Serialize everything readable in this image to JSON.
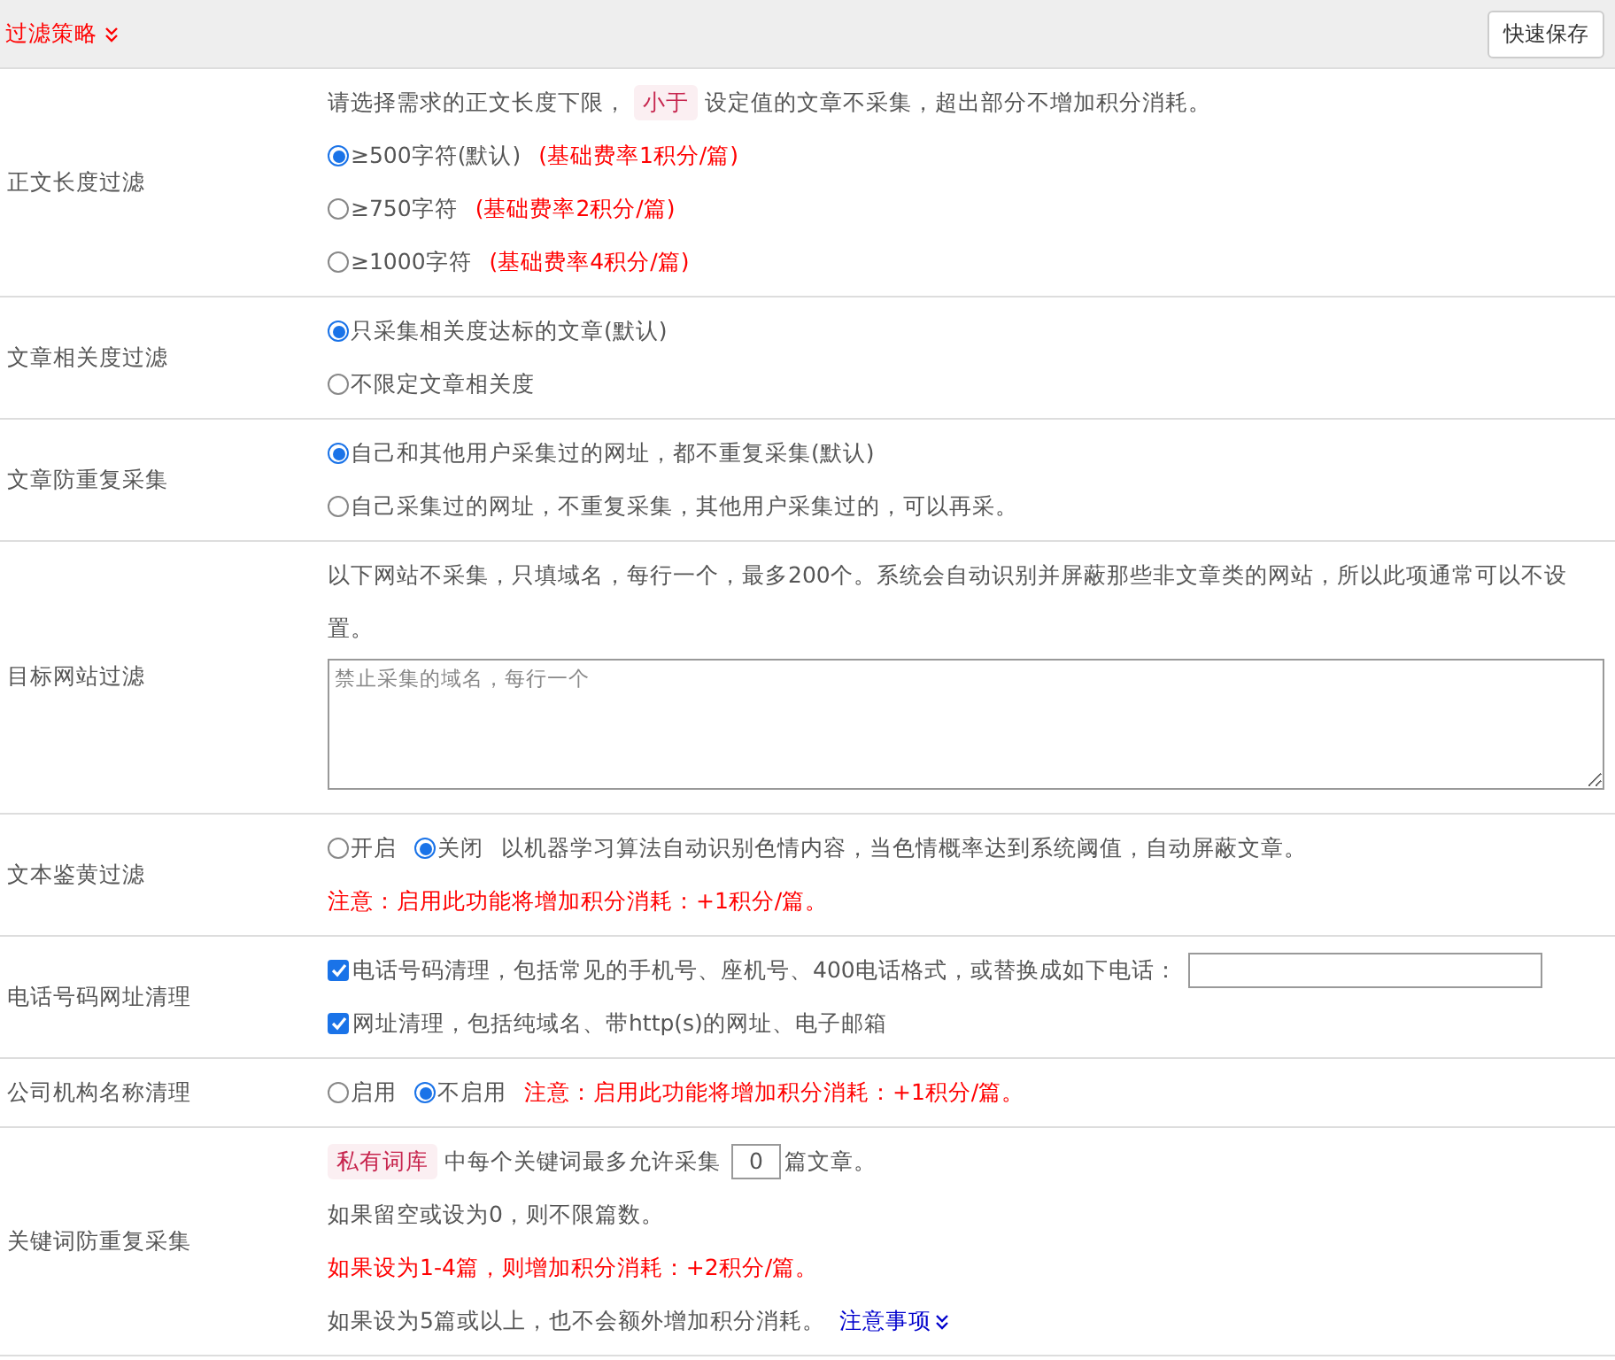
{
  "header": {
    "title": "过滤策略",
    "save_button": "快速保存"
  },
  "rows": [
    {
      "label": "正文长度过滤",
      "lines": [
        {
          "kind": "text",
          "parts": [
            {
              "kind": "plain",
              "text": "请选择需求的正文长度下限，"
            },
            {
              "kind": "tag",
              "text": "小于"
            },
            {
              "kind": "plain",
              "text": "设定值的文章不采集，超出部分不增加积分消耗。"
            }
          ]
        },
        {
          "kind": "options",
          "options": [
            {
              "label": "≥500字符(默认)",
              "selected": true
            }
          ],
          "parts": [
            {
              "kind": "red",
              "text": "(基础费率1积分/篇)"
            }
          ]
        },
        {
          "kind": "options",
          "options": [
            {
              "label": "≥750字符",
              "selected": false
            }
          ],
          "parts": [
            {
              "kind": "red",
              "text": "(基础费率2积分/篇)"
            }
          ]
        },
        {
          "kind": "options",
          "options": [
            {
              "label": "≥1000字符",
              "selected": false
            }
          ],
          "parts": [
            {
              "kind": "red",
              "text": "(基础费率4积分/篇)"
            }
          ]
        }
      ]
    },
    {
      "label": "文章相关度过滤",
      "lines": [
        {
          "kind": "options",
          "options": [
            {
              "label": "只采集相关度达标的文章(默认)",
              "selected": true
            }
          ]
        },
        {
          "kind": "options",
          "options": [
            {
              "label": "不限定文章相关度",
              "selected": false
            }
          ]
        }
      ]
    },
    {
      "label": "文章防重复采集",
      "lines": [
        {
          "kind": "options",
          "options": [
            {
              "label": "自己和其他用户采集过的网址，都不重复采集(默认)",
              "selected": true
            }
          ]
        },
        {
          "kind": "options",
          "options": [
            {
              "label": "自己采集过的网址，不重复采集，其他用户采集过的，可以再采。",
              "selected": false
            }
          ]
        }
      ]
    },
    {
      "label": "目标网站过滤",
      "lines": [
        {
          "kind": "text",
          "parts": [
            {
              "kind": "plain",
              "text": "以下网站不采集，只填域名，每行一个，最多200个。系统会自动识别并屏蔽那些非文章类的网站，所以此项通常可以不设置。"
            }
          ]
        },
        {
          "kind": "textarea",
          "placeholder": "禁止采集的域名，每行一个"
        }
      ]
    },
    {
      "label": "文本鉴黄过滤",
      "lines": [
        {
          "kind": "options",
          "options": [
            {
              "label": "开启",
              "selected": false
            },
            {
              "label": "关闭",
              "selected": true
            }
          ],
          "parts": [
            {
              "kind": "plain",
              "text": "以机器学习算法自动识别色情内容，当色情概率达到系统阈值，自动屏蔽文章。"
            }
          ]
        },
        {
          "kind": "text",
          "parts": [
            {
              "kind": "red",
              "text": "注意：启用此功能将增加积分消耗：+1积分/篇。"
            }
          ]
        }
      ]
    },
    {
      "label": "电话号码网址清理",
      "lines": [
        {
          "kind": "check",
          "checked": true,
          "parts": [
            {
              "kind": "plain",
              "text": "电话号码清理，包括常见的手机号、座机号、400电话格式，或替换成如下电话："
            },
            {
              "kind": "field"
            }
          ]
        },
        {
          "kind": "check",
          "checked": true,
          "parts": [
            {
              "kind": "plain",
              "text": "网址清理，包括纯域名、带http(s)的网址、电子邮箱"
            }
          ]
        }
      ]
    },
    {
      "label": "公司机构名称清理",
      "lines": [
        {
          "kind": "options",
          "options": [
            {
              "label": "启用",
              "selected": false
            },
            {
              "label": "不启用",
              "selected": true
            }
          ],
          "parts": [
            {
              "kind": "red",
              "text": "注意：启用此功能将增加积分消耗：+1积分/篇。"
            }
          ]
        }
      ]
    },
    {
      "label": "关键词防重复采集",
      "lines": [
        {
          "kind": "text",
          "parts": [
            {
              "kind": "tag",
              "text": "私有词库"
            },
            {
              "kind": "plain",
              "text": "中每个关键词最多允许采集"
            },
            {
              "kind": "field",
              "text": "0"
            },
            {
              "kind": "plain",
              "text": "篇文章。"
            }
          ]
        },
        {
          "kind": "text",
          "parts": [
            {
              "kind": "plain",
              "text": "如果留空或设为0，则不限篇数。"
            }
          ]
        },
        {
          "kind": "text",
          "parts": [
            {
              "kind": "red",
              "text": "如果设为1-4篇，则增加积分消耗：+2积分/篇。"
            }
          ]
        },
        {
          "kind": "text",
          "parts": [
            {
              "kind": "plain",
              "text": "如果设为5篇或以上，也不会额外增加积分消耗。"
            },
            {
              "kind": "link",
              "text": "注意事项"
            }
          ]
        }
      ]
    }
  ]
}
